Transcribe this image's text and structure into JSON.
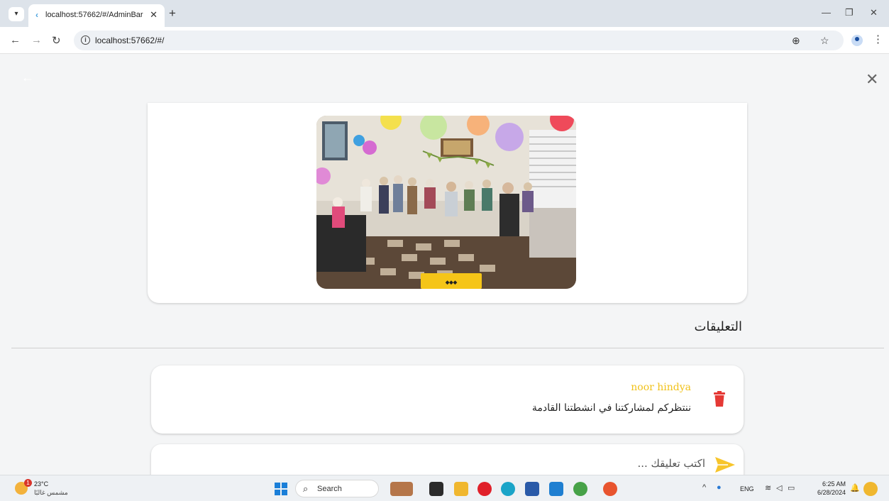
{
  "browser": {
    "tab_title": "localhost:57662/#/AdminBar",
    "url": "localhost:57662/#/"
  },
  "page": {
    "comments_heading": "التعليقات",
    "comment": {
      "author": "noor hindya",
      "text": "ننتظركم لمشاركتنا في انشطتنا القادمة"
    },
    "input_placeholder": "اكتب تعليقك ...",
    "colors": {
      "author": "#f1c21b",
      "delete": "#e53935",
      "send": "#f7c52b"
    }
  },
  "taskbar": {
    "weather_temp": "23°C",
    "weather_desc": "مشمس غالبًا",
    "weather_badge": "1",
    "search_label": "Search",
    "lang": "ENG",
    "time": "6:25 AM",
    "date": "6/28/2024"
  }
}
